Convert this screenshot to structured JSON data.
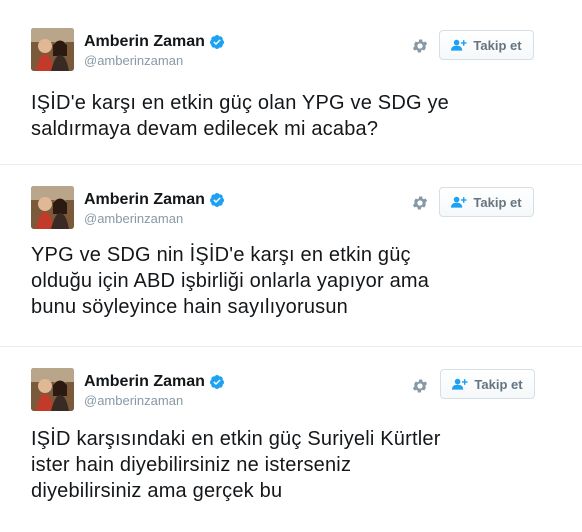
{
  "accent_color": "#1da1f2",
  "tweets": [
    {
      "author": {
        "name": "Amberin Zaman",
        "handle": "@amberinzaman",
        "verified": true
      },
      "follow_label": "Takip et",
      "settings_icon": "gear-icon",
      "text": "IŞİD'e karşı en etkin güç olan YPG ve SDG ye\nsaldırmaya devam edilecek mi acaba?"
    },
    {
      "author": {
        "name": "Amberin Zaman",
        "handle": "@amberinzaman",
        "verified": true
      },
      "follow_label": "Takip et",
      "settings_icon": "gear-icon",
      "text": "YPG ve SDG nin İŞİD'e karşı en etkin güç\nolduğu için ABD işbirliği  onlarla yapıyor ama\nbunu söyleyince hain sayılıyorusun"
    },
    {
      "author": {
        "name": "Amberin Zaman",
        "handle": "@amberinzaman",
        "verified": true
      },
      "follow_label": "Takip et",
      "settings_icon": "gear-icon",
      "text": "IŞİD karşısındaki en etkin güç Suriyeli Kürtler\nister hain diyebilirsiniz ne isterseniz\ndiyebilirsiniz ama gerçek bu"
    }
  ]
}
